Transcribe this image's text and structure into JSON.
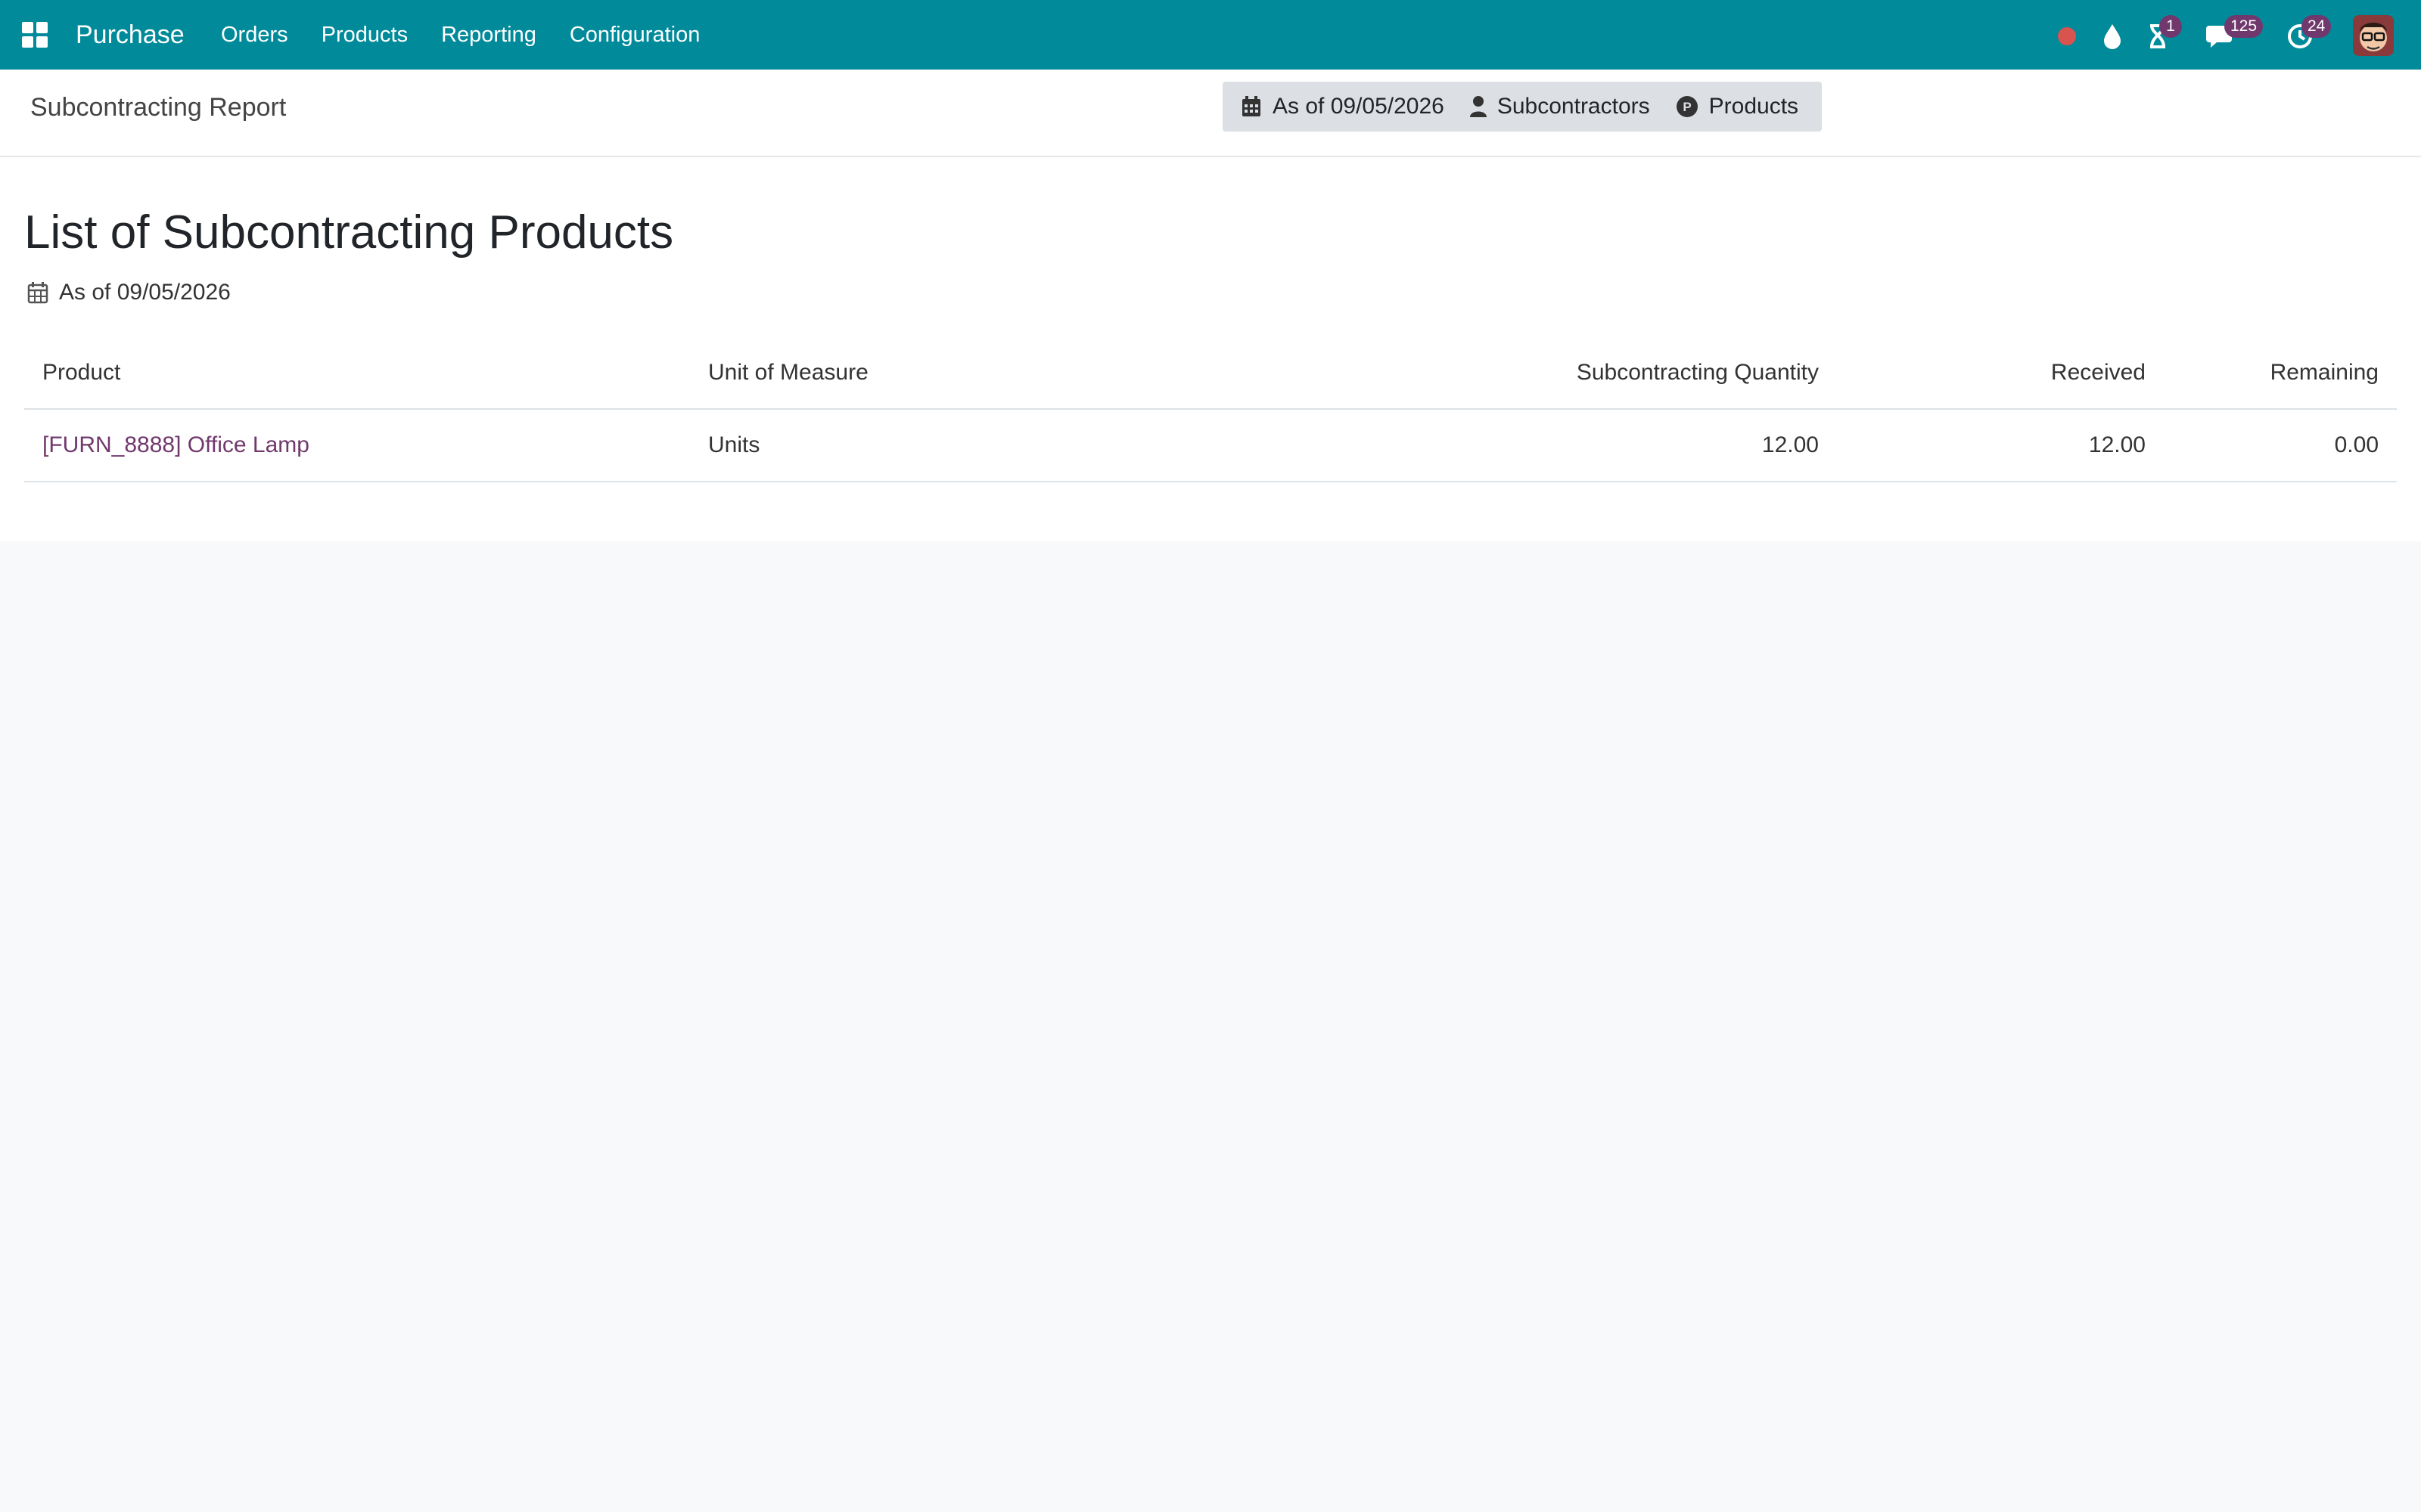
{
  "navbar": {
    "app_name": "Purchase",
    "menu": [
      "Orders",
      "Products",
      "Reporting",
      "Configuration"
    ],
    "badges": {
      "activities": "1",
      "messages": "125",
      "clock": "24"
    },
    "color": "#018a9a",
    "badge_color": "#71386d"
  },
  "control_panel": {
    "breadcrumb": "Subcontracting Report",
    "filters": {
      "date": "As of 09/05/2026",
      "subcontractors": "Subcontractors",
      "products": "Products"
    }
  },
  "report": {
    "title": "List of Subcontracting Products",
    "date": "As of 09/05/2026",
    "columns": [
      "Product",
      "Unit of Measure",
      "Subcontracting Quantity",
      "Received",
      "Remaining"
    ],
    "rows": [
      {
        "product": "[FURN_8888] Office Lamp",
        "uom": "Units",
        "subcontracting_qty": "12.00",
        "received": "12.00",
        "remaining": "0.00"
      }
    ]
  },
  "icons": [
    "apps-grid-icon",
    "record-dot-icon",
    "drop-icon",
    "hourglass-icon",
    "chat-icon",
    "clock-icon",
    "calendar-icon",
    "user-icon",
    "product-p-icon"
  ]
}
